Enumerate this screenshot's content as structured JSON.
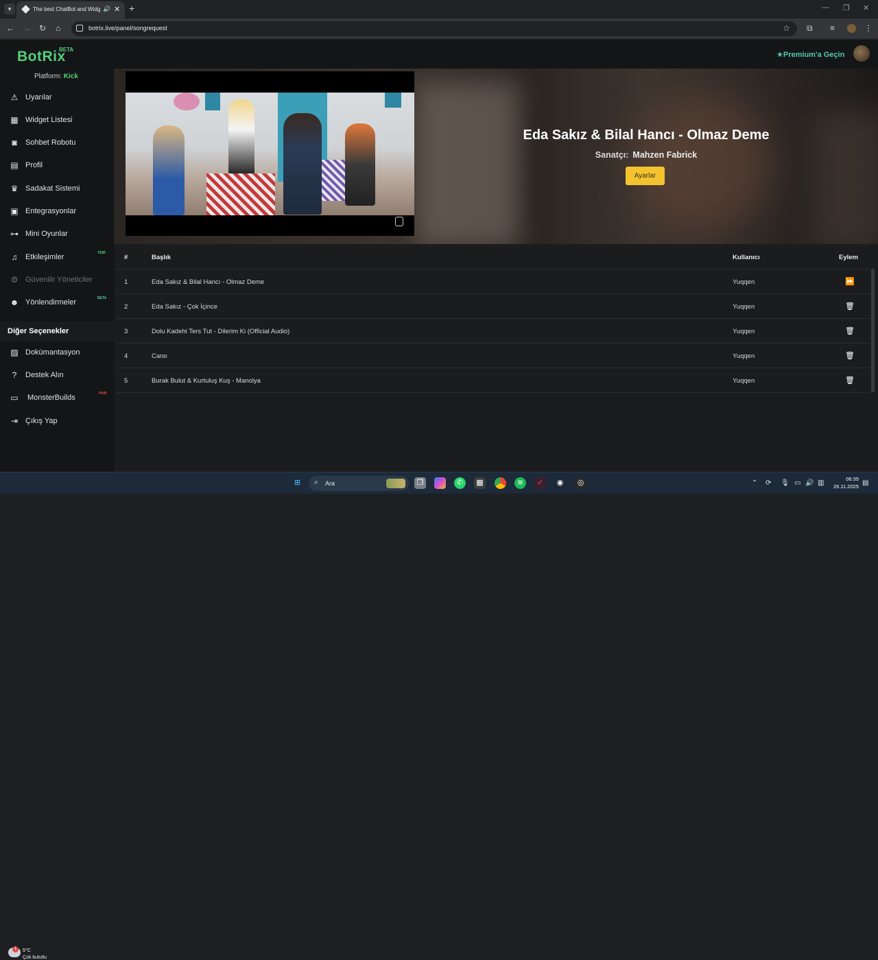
{
  "browser": {
    "tab_title": "The best ChatBot and Widg",
    "url": "botrix.live/panel/songrequest"
  },
  "header": {
    "logo": "BotRix",
    "logo_badge": "BETA",
    "premium": "Premium'a Geçin"
  },
  "sidebar": {
    "platform_label": "Platform:",
    "platform_value": "Kick",
    "items": [
      {
        "label": "Uyarılar",
        "icon": "warning-icon"
      },
      {
        "label": "Widget Listesi",
        "icon": "grid-icon"
      },
      {
        "label": "Sohbet Robotu",
        "icon": "robot-icon"
      },
      {
        "label": "Profil",
        "icon": "id-card-icon"
      },
      {
        "label": "Sadakat Sistemi",
        "icon": "trophy-icon"
      },
      {
        "label": "Entegrasyonlar",
        "icon": "plug-icon"
      },
      {
        "label": "Mini Oyunlar",
        "icon": "gamepad-icon"
      },
      {
        "label": "Etkileşimler",
        "icon": "music-icon",
        "badge": "YENİ",
        "badge_color": "#52d07a"
      },
      {
        "label": "Güvenilir Yöneticiler",
        "icon": "users-cog-icon",
        "disabled": true
      },
      {
        "label": "Yönlendirmeler",
        "icon": "user-group-icon",
        "badge": "BETA",
        "badge_color": "#54c6b1"
      }
    ],
    "section_title": "Diğer Seçenekler",
    "other_items": [
      {
        "label": "Dokümantasyon",
        "icon": "scroll-icon"
      },
      {
        "label": "Destek Alın",
        "icon": "question-circle-icon"
      },
      {
        "label": "MonsterBuilds",
        "icon": "laptop-icon",
        "badge": "PAID",
        "badge_color": "#d44a4a"
      },
      {
        "label": "Çıkış Yap",
        "icon": "logout-icon"
      }
    ]
  },
  "now_playing": {
    "title": "Eda Sakız & Bilal Hancı - Olmaz Deme",
    "artist_label": "Sanatçı:",
    "artist": "Mahzen Fabrick",
    "settings_button": "Ayarlar"
  },
  "queue": {
    "headers": {
      "num": "#",
      "title": "Başlık",
      "user": "Kullanıcı",
      "action": "Eylem"
    },
    "rows": [
      {
        "num": "1",
        "title": "Eda Sakız & Bilal Hancı - Olmaz Deme",
        "user": "Yuqqen",
        "action_icon": "skip-forward-icon"
      },
      {
        "num": "2",
        "title": "Eda Sakız - Çok İçince",
        "user": "Yuqqen",
        "action_icon": "trash-icon"
      },
      {
        "num": "3",
        "title": "Dolu Kadehi Ters Tut - Dilerim Ki (Official Audio)",
        "user": "Yuqqen",
        "action_icon": "trash-icon"
      },
      {
        "num": "4",
        "title": "Cano",
        "user": "Yuqqen",
        "action_icon": "trash-icon"
      },
      {
        "num": "5",
        "title": "Burak Bulut & Kurtuluş Kuş - Manolya",
        "user": "Yuqqen",
        "action_icon": "trash-icon"
      }
    ]
  },
  "taskbar": {
    "weather_temp": "5°C",
    "weather_desc": "Çok bulutlu",
    "weather_badge": "1",
    "search_placeholder": "Ara",
    "time": "06:35",
    "date": "26.11.2025"
  }
}
